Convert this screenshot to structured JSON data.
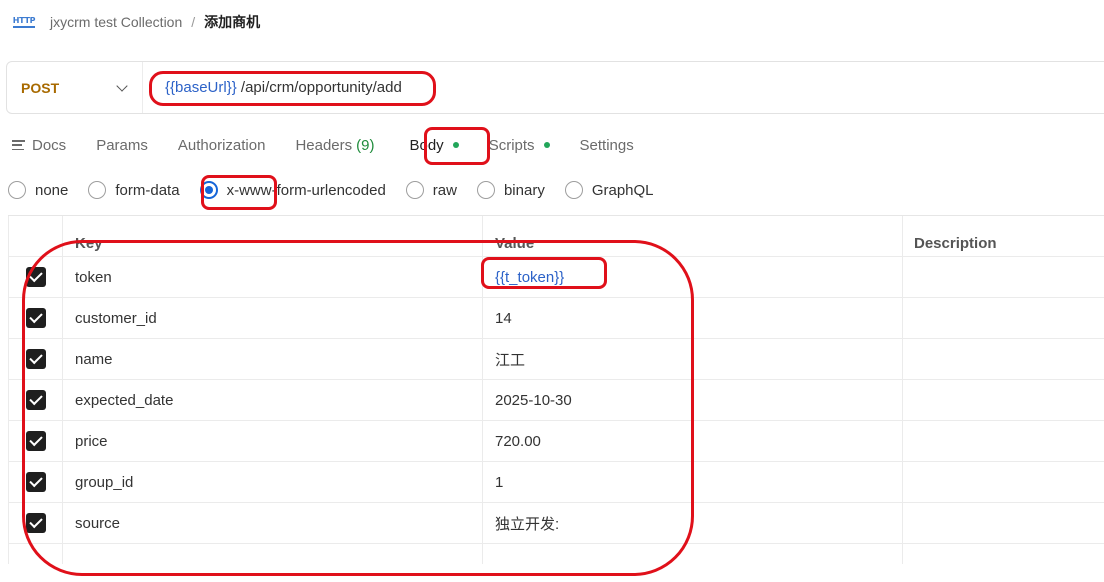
{
  "breadcrumb": {
    "icon_text": "HTTP",
    "collection": "jxycrm test Collection",
    "separator": "/",
    "current": "添加商机"
  },
  "request": {
    "method": "POST",
    "url_variable": "{{baseUrl}}",
    "url_path": "/api/crm/opportunity/add"
  },
  "tabs": [
    {
      "label": "Docs"
    },
    {
      "label": "Params"
    },
    {
      "label": "Authorization"
    },
    {
      "label": "Headers",
      "count": "(9)"
    },
    {
      "label": "Body",
      "dot": true
    },
    {
      "label": "Scripts",
      "dot": true
    },
    {
      "label": "Settings"
    }
  ],
  "body_types": [
    {
      "label": "none",
      "selected": false
    },
    {
      "label": "form-data",
      "selected": false
    },
    {
      "label": "x-www-form-urlencoded",
      "selected": true
    },
    {
      "label": "raw",
      "selected": false
    },
    {
      "label": "binary",
      "selected": false
    },
    {
      "label": "GraphQL",
      "selected": false
    }
  ],
  "table": {
    "headers": {
      "key": "Key",
      "value": "Value",
      "description": "Description"
    },
    "rows": [
      {
        "key": "token",
        "value": "{{t_token}}",
        "checked": true
      },
      {
        "key": "customer_id",
        "value": "14",
        "checked": true
      },
      {
        "key": "name",
        "value": "江工",
        "checked": true
      },
      {
        "key": "expected_date",
        "value": "2025-10-30",
        "checked": true
      },
      {
        "key": "price",
        "value": "720.00",
        "checked": true
      },
      {
        "key": "group_id",
        "value": "1",
        "checked": true
      },
      {
        "key": "source",
        "value": "独立开发:",
        "checked": true
      }
    ]
  },
  "colors": {
    "annotation": "#e0101a",
    "method": "#a86a00",
    "variable": "#2c62c8",
    "dot": "#22a65a",
    "radio_selected": "#1565d8"
  }
}
